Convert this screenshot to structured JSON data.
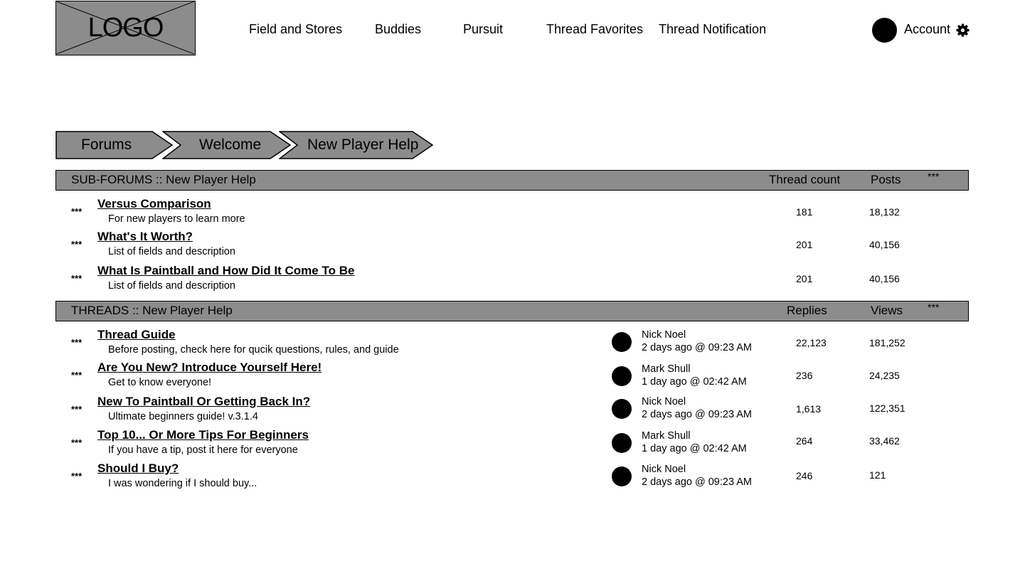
{
  "header": {
    "logo_text": "LOGO",
    "nav": [
      "Field and Stores",
      "Buddies",
      "Pursuit",
      "Thread Favorites",
      "Thread Notification"
    ],
    "account_label": "Account",
    "settings_icon": "gear-icon"
  },
  "breadcrumb": [
    "Forums",
    "Welcome",
    "New Player Help"
  ],
  "subforums": {
    "title": "SUB-FORUMS :: New Player Help",
    "col_a": "Thread count",
    "col_b": "Posts",
    "col_c": "***",
    "rows": [
      {
        "marker": "***",
        "title": "Versus Comparison",
        "desc": "For new players to learn more",
        "count": "181",
        "posts": "18,132"
      },
      {
        "marker": "***",
        "title": "What's It Worth?",
        "desc": "List of fields and description",
        "count": "201",
        "posts": "40,156"
      },
      {
        "marker": "***",
        "title": "What Is Paintball and How Did It Come To Be",
        "desc": "List of fields and description",
        "count": "201",
        "posts": "40,156"
      }
    ]
  },
  "threads": {
    "title": "THREADS :: New Player Help",
    "col_a": "Replies",
    "col_b": "Views",
    "col_c": "***",
    "rows": [
      {
        "marker": "***",
        "title": "Thread Guide",
        "desc": "Before posting, check here for qucik questions, rules, and guide",
        "user": "Nick Noel",
        "time": "2 days ago @ 09:23 AM",
        "replies": "22,123",
        "views": "181,252"
      },
      {
        "marker": "***",
        "title": "Are You New? Introduce Yourself Here!",
        "desc": "Get to know everyone!",
        "user": "Mark Shull",
        "time": "1 day ago @ 02:42 AM",
        "replies": "236",
        "views": "24,235"
      },
      {
        "marker": "***",
        "title": "New To Paintball Or Getting Back In?",
        "desc": "Ultimate beginners guide! v.3.1.4",
        "user": "Nick Noel",
        "time": "2 days ago @ 09:23 AM",
        "replies": "1,613",
        "views": "122,351"
      },
      {
        "marker": "***",
        "title": "Top 10... Or More Tips For Beginners",
        "desc": "If you have a tip, post it here for everyone",
        "user": "Mark Shull",
        "time": "1 day ago @ 02:42 AM",
        "replies": "264",
        "views": "33,462"
      },
      {
        "marker": "***",
        "title": "Should I Buy?",
        "desc": "I was wondering if I should buy...",
        "user": "Nick Noel",
        "time": "2 days ago @ 09:23 AM",
        "replies": "246",
        "views": "121"
      }
    ]
  }
}
